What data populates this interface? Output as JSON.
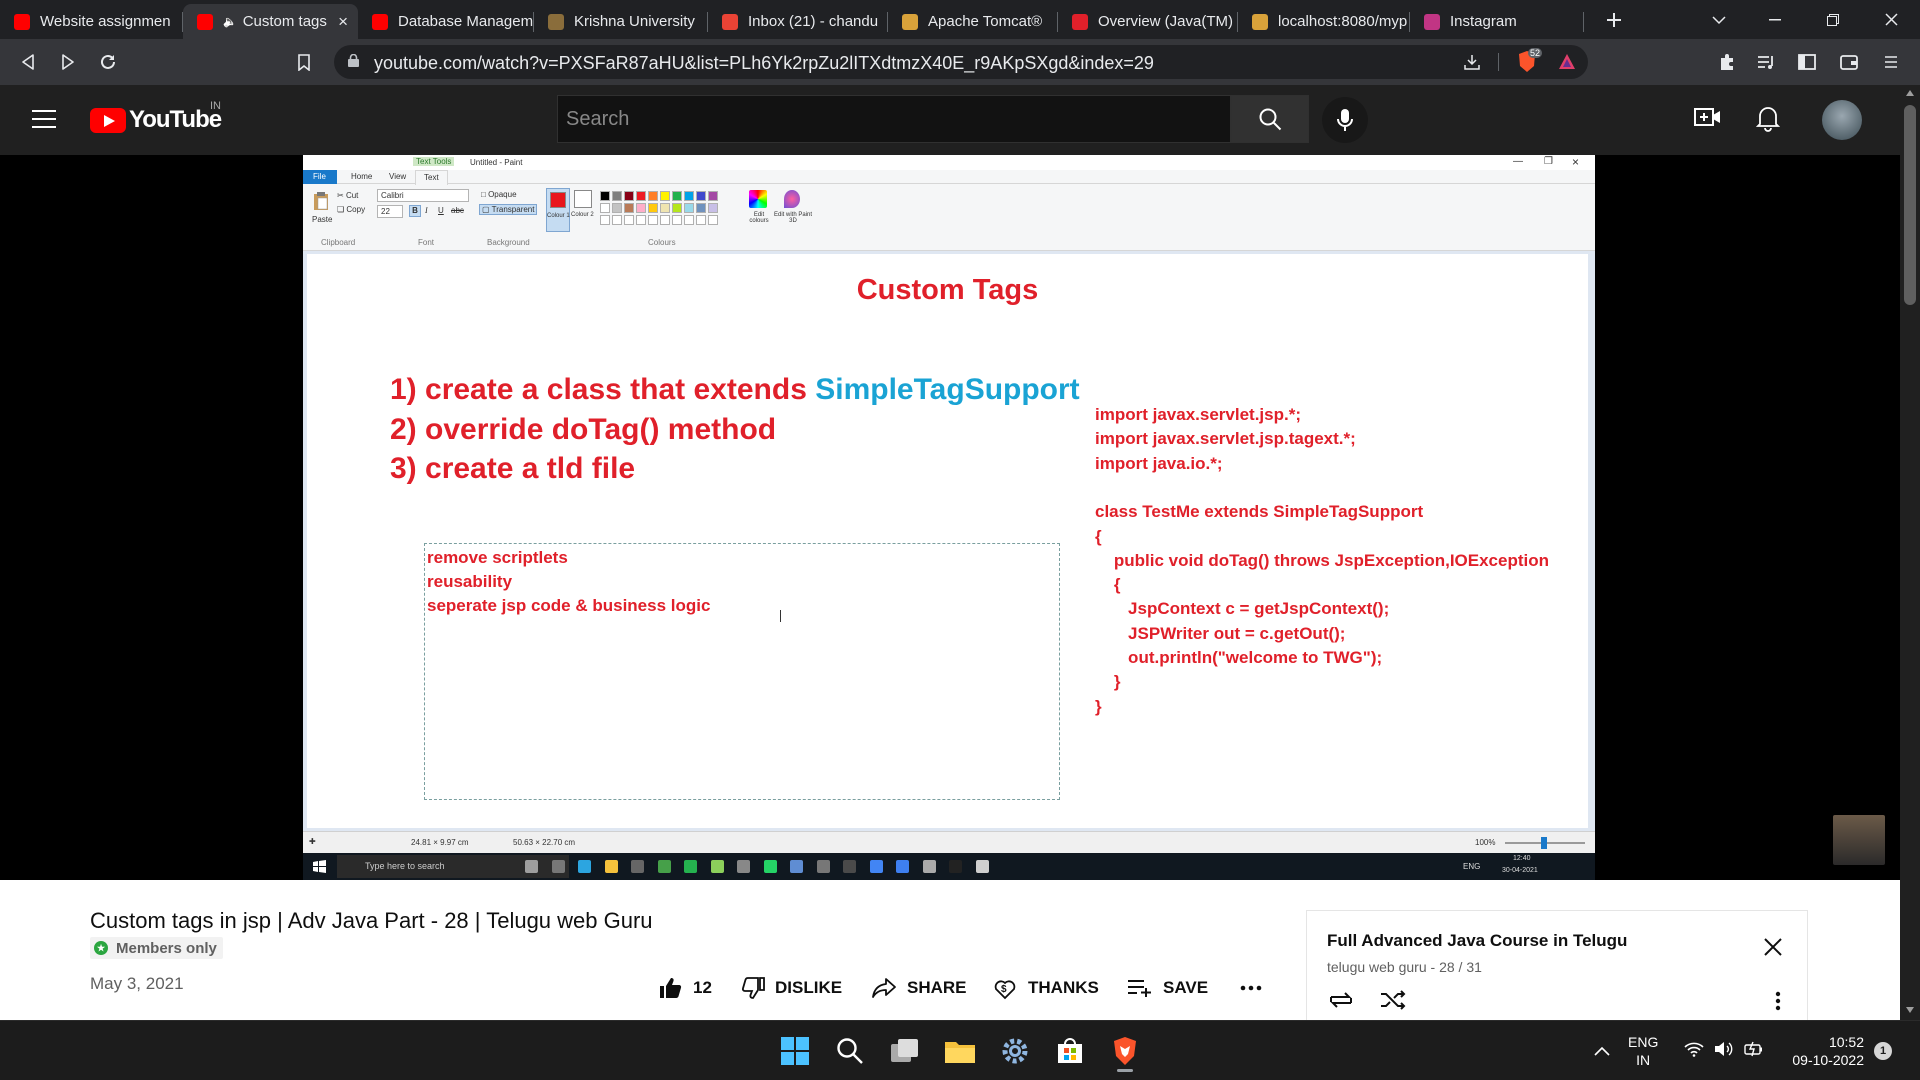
{
  "browser": {
    "tabs": [
      {
        "title": "Website assignmen",
        "favicon_color": "#ff0000"
      },
      {
        "title": "Custom tags",
        "favicon_color": "#ff0000",
        "active": true
      },
      {
        "title": "Database Managem",
        "favicon_color": "#ff0000"
      },
      {
        "title": "Krishna University",
        "favicon_color": "#8a6d3b"
      },
      {
        "title": "Inbox (21) - chandu",
        "favicon_color": "#ea4335"
      },
      {
        "title": "Apache Tomcat®",
        "favicon_color": "#d9a23a"
      },
      {
        "title": "Overview (Java(TM)",
        "favicon_color": "#e0202a"
      },
      {
        "title": "localhost:8080/myp",
        "favicon_color": "#d9a23a"
      },
      {
        "title": "Instagram",
        "favicon_color": "#c13584"
      }
    ],
    "new_tab_icon": "plus-icon",
    "url": "youtube.com/watch?v=PXSFaR87aHU&list=PLh6Yk2rpZu2lITXdtmzX40E_r9AKpSXgd&index=29",
    "shield_count": "52"
  },
  "youtube": {
    "logo_text": "YouTube",
    "country": "IN",
    "search_placeholder": "Search"
  },
  "paint": {
    "window_title": "Untitled - Paint",
    "context_tab": "Text Tools",
    "tabs": [
      "File",
      "Home",
      "View",
      "Text"
    ],
    "clipboard": {
      "paste": "Paste",
      "cut": "Cut",
      "copy": "Copy",
      "group": "Clipboard"
    },
    "font": {
      "name": "Calibri",
      "size": "22",
      "group": "Font"
    },
    "background": {
      "opaque": "Opaque",
      "transparent": "Transparent",
      "group": "Background"
    },
    "colours": {
      "c1": "Colour 1",
      "c2": "Colour 2",
      "edit": "Edit colours",
      "paint3d": "Edit with Paint 3D",
      "group": "Colours"
    },
    "status_left": "24.81 × 9.97 cm",
    "status_mid": "50.63 × 22.70 cm",
    "zoom": "100%"
  },
  "slide": {
    "title": "Custom Tags",
    "steps": [
      {
        "text": "1) create a class that extends ",
        "highlight": "SimpleTagSupport"
      },
      {
        "text": "2) override doTag() method",
        "highlight": ""
      },
      {
        "text": "3) create a tld file",
        "highlight": ""
      }
    ],
    "textbox_lines": [
      "remove scriptlets",
      "reusability",
      "seperate jsp code & business logic"
    ],
    "code_lines": [
      "import javax.servlet.jsp.*;",
      "import javax.servlet.jsp.tagext.*;",
      "import java.io.*;",
      "",
      "class TestMe extends SimpleTagSupport",
      "{",
      "    public void doTag() throws JspException,IOException",
      "    {",
      "       JspContext c = getJspContext();",
      "       JSPWriter out = c.getOut();",
      "       out.println(\"welcome to TWG\");",
      "    }",
      "}"
    ]
  },
  "win10": {
    "search_placeholder": "Type here to search",
    "lang": "ENG",
    "time": "12:40",
    "date": "30-04-2021"
  },
  "video": {
    "title": "Custom tags in jsp | Adv Java Part - 28 | Telugu web Guru",
    "badge": "Members only",
    "date": "May 3, 2021",
    "likes": "12",
    "dislike": "DISLIKE",
    "share": "SHARE",
    "thanks": "THANKS",
    "save": "SAVE"
  },
  "playlist": {
    "title": "Full Advanced Java Course in Telugu",
    "channel": "telugu web guru",
    "position": "28 / 31"
  },
  "taskbar": {
    "lang_line1": "ENG",
    "lang_line2": "IN",
    "time": "10:52",
    "date": "09-10-2022",
    "notification_count": "1"
  }
}
